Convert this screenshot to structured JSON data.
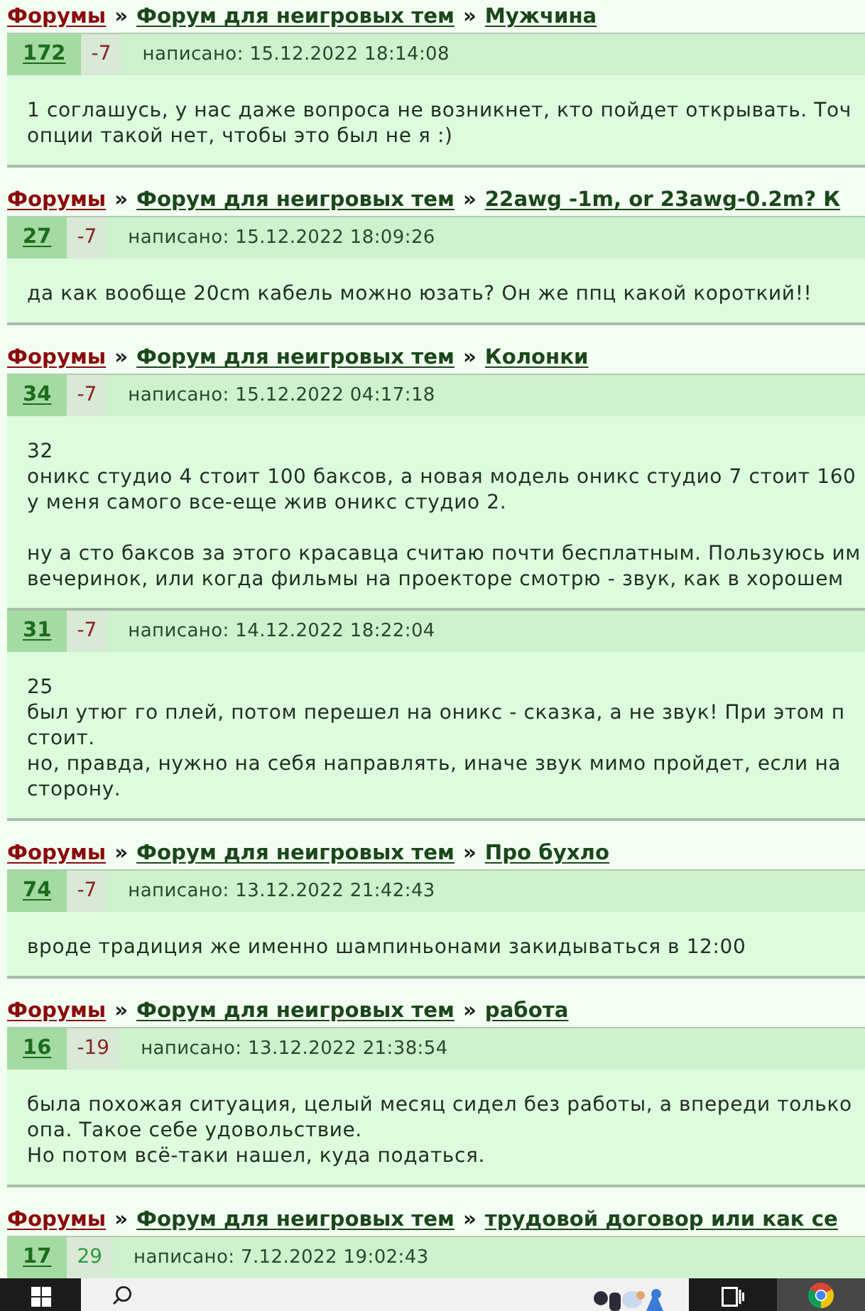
{
  "topics": [
    {
      "breadcrumb": [
        {
          "kind": "forums",
          "label": "Форумы"
        },
        {
          "kind": "section",
          "separator": "»",
          "label": "Форум для неигровых тем"
        },
        {
          "kind": "topic",
          "separator": "»",
          "label": "Мужчина"
        }
      ],
      "posts": [
        {
          "number": "172",
          "score": "-7",
          "color": "#8b2323",
          "posted": "написано: 15.12.2022 18:14:08",
          "body": "1 соглашусь, у нас даже вопроса не возникнет, кто пойдет открывать. Точ\nопции такой нет, чтобы это был не я :)"
        }
      ]
    },
    {
      "breadcrumb": [
        {
          "kind": "forums",
          "label": "Форумы"
        },
        {
          "kind": "section",
          "separator": "»",
          "label": "Форум для неигровых тем"
        },
        {
          "kind": "topic",
          "separator": "»",
          "label": "22awg -1m, or 23awg-0.2m? К"
        }
      ],
      "posts": [
        {
          "number": "27",
          "score": "-7",
          "color": "#8b2323",
          "posted": "написано: 15.12.2022 18:09:26",
          "body": "да как вообще 20cm кабель можно юзать? Он же ппц какой короткий!!"
        }
      ]
    },
    {
      "breadcrumb": [
        {
          "kind": "forums",
          "label": "Форумы"
        },
        {
          "kind": "section",
          "separator": "»",
          "label": "Форум для неигровых тем"
        },
        {
          "kind": "topic",
          "separator": "»",
          "label": "Колонки"
        }
      ],
      "posts": [
        {
          "number": "34",
          "score": "-7",
          "color": "#8b2323",
          "posted": "написано: 15.12.2022 04:17:18",
          "body": "32\nоникс студио 4 стоит 100 баксов, а новая модель оникс студио 7 стоит 160\nу меня самого все-еще жив оникс студио 2.\n\nну а сто баксов за этого красавца считаю почти бесплатным. Пользуюсь им\nвечеринок, или когда фильмы на проекторе смотрю - звук, как в хорошем"
        },
        {
          "number": "31",
          "score": "-7",
          "color": "#8b2323",
          "posted": "написано: 14.12.2022 18:22:04",
          "body": "25\nбыл утюг го плей, потом перешел на оникс - сказка, а не звук! При этом п\nстоит.\nно, правда, нужно на себя направлять, иначе звук мимо пройдет, если на\nсторону."
        }
      ]
    },
    {
      "breadcrumb": [
        {
          "kind": "forums",
          "label": "Форумы"
        },
        {
          "kind": "section",
          "separator": "»",
          "label": "Форум для неигровых тем"
        },
        {
          "kind": "topic",
          "separator": "»",
          "label": "Про бухло"
        }
      ],
      "posts": [
        {
          "number": "74",
          "score": "-7",
          "color": "#8b2323",
          "posted": "написано: 13.12.2022 21:42:43",
          "body": "вроде традиция же именно шампиньонами закидываться в 12:00"
        }
      ]
    },
    {
      "breadcrumb": [
        {
          "kind": "forums",
          "label": "Форумы"
        },
        {
          "kind": "section",
          "separator": "»",
          "label": "Форум для неигровых тем"
        },
        {
          "kind": "topic",
          "separator": "»",
          "label": "работа"
        }
      ],
      "posts": [
        {
          "number": "16",
          "score": "-19",
          "color": "#8b2323",
          "posted": "написано: 13.12.2022 21:38:54",
          "body": "была похожая ситуация, целый месяц сидел без работы, а впереди только\nопа. Такое себе удовольствие.\nНо потом всё-таки нашел, куда податься."
        }
      ]
    },
    {
      "breadcrumb": [
        {
          "kind": "forums",
          "label": "Форумы"
        },
        {
          "kind": "section",
          "separator": "»",
          "label": "Форум для неигровых тем"
        },
        {
          "kind": "topic",
          "separator": "»",
          "label": "трудовой договор или как се"
        }
      ],
      "posts": [
        {
          "number": "17",
          "score": "29",
          "color": "#2e9a38",
          "posted": "написано: 7.12.2022 19:02:43"
        }
      ]
    }
  ],
  "taskbar": {
    "apps": [
      {
        "kind": "task_view",
        "active": false
      },
      {
        "kind": "browser",
        "active": true
      }
    ]
  }
}
